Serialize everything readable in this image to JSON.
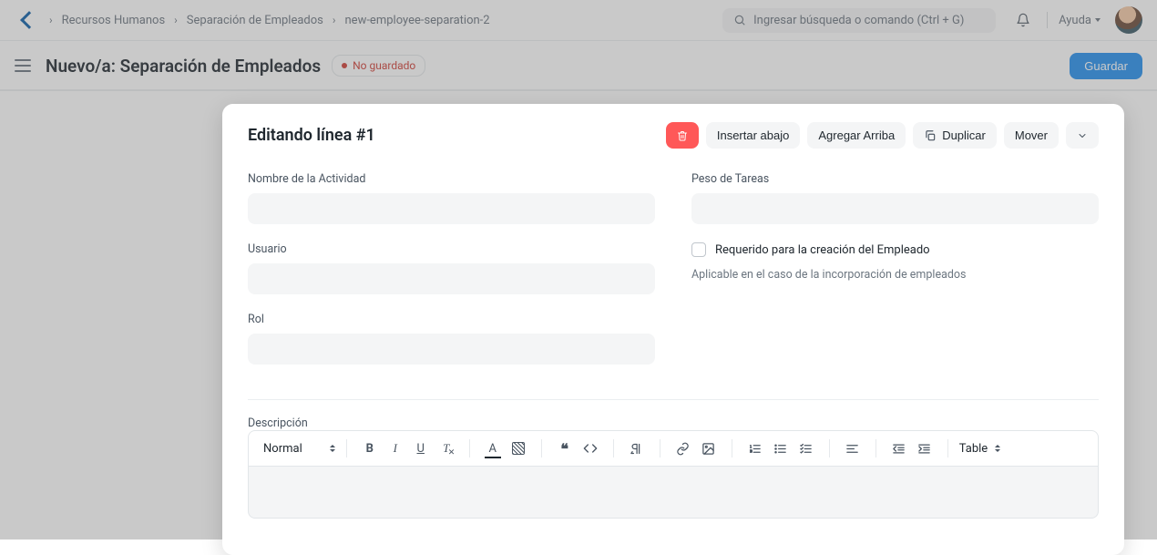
{
  "breadcrumb": {
    "items": [
      "Recursos Humanos",
      "Separación de Empleados",
      "new-employee-separation-2"
    ]
  },
  "search": {
    "placeholder": "Ingresar búsqueda o comando (Ctrl + G)"
  },
  "help": {
    "label": "Ayuda"
  },
  "page": {
    "title": "Nuevo/a: Separación de Empleados",
    "unsaved_label": "No guardado",
    "save_label": "Guardar"
  },
  "modal": {
    "title": "Editando línea #1",
    "toolbar": {
      "insert_below": "Insertar abajo",
      "insert_above": "Agregar Arriba",
      "duplicate": "Duplicar",
      "move": "Mover"
    },
    "fields": {
      "activity_name_label": "Nombre de la Actividad",
      "activity_name_value": "",
      "user_label": "Usuario",
      "user_value": "",
      "role_label": "Rol",
      "role_value": "",
      "task_weight_label": "Peso de Tareas",
      "task_weight_value": "",
      "required_label": "Requerido para la creación del Empleado",
      "required_checked": false,
      "required_helper": "Aplicable en el caso de la incorporación de empleados",
      "description_label": "Descripción"
    },
    "editor": {
      "format_label": "Normal",
      "table_label": "Table"
    }
  }
}
